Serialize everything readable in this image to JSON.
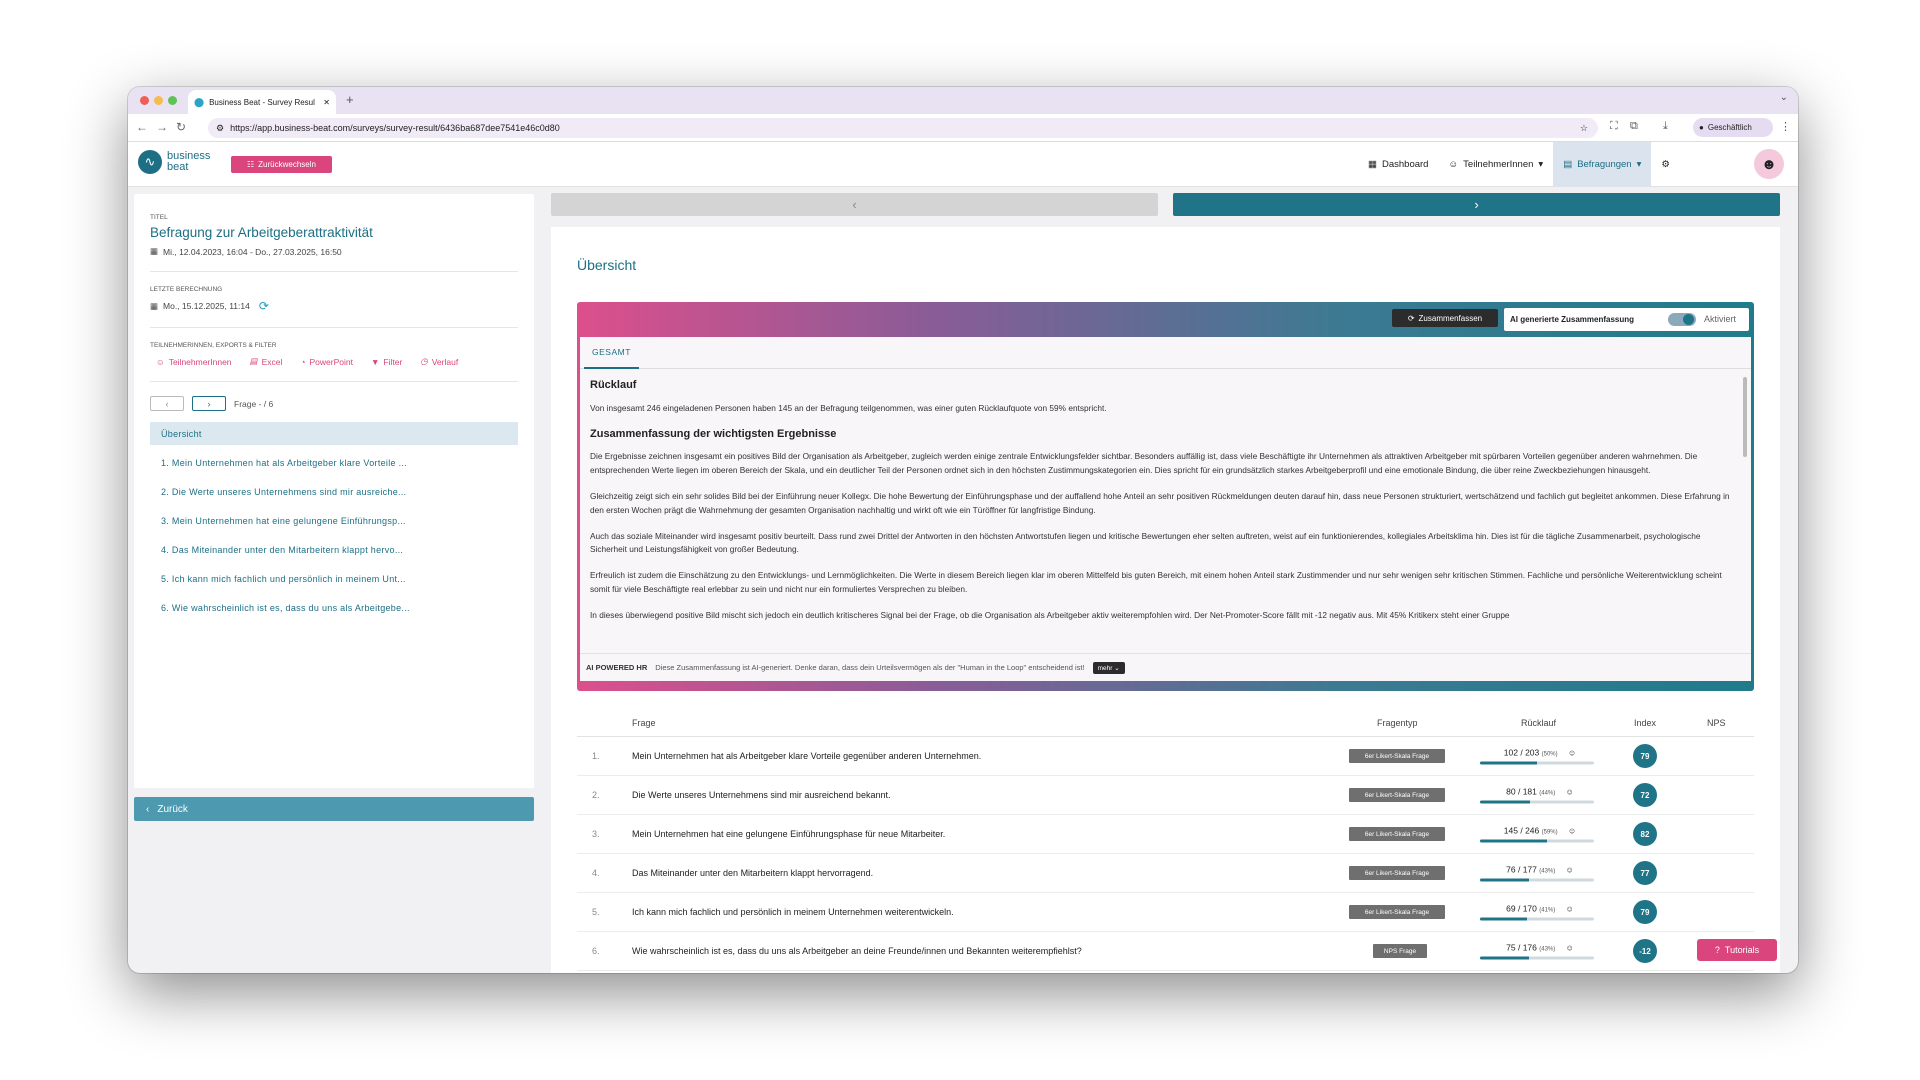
{
  "browser": {
    "tab_title": "Business Beat - Survey Resul",
    "url": "https://app.business-beat.com/surveys/survey-result/6436ba687dee7541e46c0d80",
    "profile_label": "Geschäftlich"
  },
  "header": {
    "logo_line1": "business",
    "logo_line2": "beat",
    "switch_label": "Zurückwechseln",
    "nav": {
      "dashboard": "Dashboard",
      "participants": "TeilnehmerInnen",
      "surveys": "Befragungen"
    }
  },
  "sidebar": {
    "title_label": "TITEL",
    "survey_title": "Befragung zur Arbeitgeberattraktivität",
    "date_range": "Mi., 12.04.2023, 16:04 - Do., 27.03.2025, 16:50",
    "last_calc_label": "LETZTE BERECHNUNG",
    "last_calc": "Mo., 15.12.2025, 11:14",
    "exports_label": "TEILNEHMERINNEN, EXPORTS & FILTER",
    "exports": {
      "participants": "TeilnehmerInnen",
      "excel": "Excel",
      "powerpoint": "PowerPoint",
      "filter": "Filter",
      "history": "Verlauf"
    },
    "question_counter": "Frage - / 6",
    "items": [
      {
        "label": "Übersicht"
      },
      {
        "label": "1. Mein Unternehmen hat als Arbeitgeber klare Vorteile ..."
      },
      {
        "label": "2. Die Werte unseres Unternehmens sind mir ausreiche..."
      },
      {
        "label": "3. Mein Unternehmen hat eine gelungene Einführungsp..."
      },
      {
        "label": "4. Das Miteinander unter den Mitarbeitern klappt hervo..."
      },
      {
        "label": "5. Ich kann mich fachlich und persönlich in meinem Unt..."
      },
      {
        "label": "6. Wie wahrscheinlich ist es, dass du uns als Arbeitgebe..."
      }
    ],
    "back_label": "Zurück"
  },
  "main": {
    "title": "Übersicht",
    "ai": {
      "summarize_label": "Zusammenfassen",
      "toggle_label": "AI generierte Zusammenfassung",
      "toggle_state": "Aktiviert",
      "tab_label": "GESAMT",
      "h_response": "Rücklauf",
      "p_response": "Von insgesamt 246 eingeladenen Personen haben 145 an der Befragung teilgenommen, was einer guten Rücklaufquote von 59% entspricht.",
      "h_summary": "Zusammenfassung der wichtigsten Ergebnisse",
      "p1": "Die Ergebnisse zeichnen insgesamt ein positives Bild der Organisation als Arbeitgeber, zugleich werden einige zentrale Entwicklungsfelder sichtbar. Besonders auffällig ist, dass viele Beschäftigte ihr Unternehmen als attraktiven Arbeitgeber mit spürbaren Vorteilen gegenüber anderen wahrnehmen. Die entsprechenden Werte liegen im oberen Bereich der Skala, und ein deutlicher Teil der Personen ordnet sich in den höchsten Zustimmungskategorien ein. Dies spricht für ein grundsätzlich starkes Arbeitgeberprofil und eine emotionale Bindung, die über reine Zweckbeziehungen hinausgeht.",
      "p2": "Gleichzeitig zeigt sich ein sehr solides Bild bei der Einführung neuer Kollegx. Die hohe Bewertung der Einführungsphase und der auffallend hohe Anteil an sehr positiven Rückmeldungen deuten darauf hin, dass neue Personen strukturiert, wertschätzend und fachlich gut begleitet ankommen. Diese Erfahrung in den ersten Wochen prägt die Wahrnehmung der gesamten Organisation nachhaltig und wirkt oft wie ein Türöffner für langfristige Bindung.",
      "p3": "Auch das soziale Miteinander wird insgesamt positiv beurteilt. Dass rund zwei Drittel der Antworten in den höchsten Antwortstufen liegen und kritische Bewertungen eher selten auftreten, weist auf ein funktionierendes, kollegiales Arbeitsklima hin. Dies ist für die tägliche Zusammenarbeit, psychologische Sicherheit und Leistungsfähigkeit von großer Bedeutung.",
      "p4": "Erfreulich ist zudem die Einschätzung zu den Entwicklungs- und Lernmöglichkeiten. Die Werte in diesem Bereich liegen klar im oberen Mittelfeld bis guten Bereich, mit einem hohen Anteil stark Zustimmender und nur sehr wenigen sehr kritischen Stimmen. Fachliche und persönliche Weiterentwicklung scheint somit für viele Beschäftigte real erlebbar zu sein und nicht nur ein formuliertes Versprechen zu bleiben.",
      "p5": "In dieses überwiegend positive Bild mischt sich jedoch ein deutlich kritischeres Signal bei der Frage, ob die Organisation als Arbeitgeber aktiv weiterempfohlen wird. Der Net-Promoter-Score fällt mit -12 negativ aus. Mit 45% Kritikerx steht einer Gruppe",
      "footer_brand": "AI POWERED HR",
      "footer_note": "Diese Zusammenfassung ist AI-generiert. Denke daran, dass dein Urteilsvermögen als der \"Human in the Loop\" entscheidend ist!",
      "more_label": "mehr"
    },
    "table": {
      "headers": {
        "question": "Frage",
        "type": "Fragentyp",
        "response": "Rücklauf",
        "index": "Index",
        "nps": "NPS"
      },
      "rows": [
        {
          "num": "1.",
          "question": "Mein Unternehmen hat als Arbeitgeber klare Vorteile gegenüber anderen Unternehmen.",
          "type": "6er Likert-Skala Frage",
          "response": "102 / 203",
          "pct": "(50%)",
          "fill": 0.5,
          "index": "79"
        },
        {
          "num": "2.",
          "question": "Die Werte unseres Unternehmens sind mir ausreichend bekannt.",
          "type": "6er Likert-Skala Frage",
          "response": "80 / 181",
          "pct": "(44%)",
          "fill": 0.44,
          "index": "72"
        },
        {
          "num": "3.",
          "question": "Mein Unternehmen hat eine gelungene Einführungsphase für neue Mitarbeiter.",
          "type": "6er Likert-Skala Frage",
          "response": "145 / 246",
          "pct": "(59%)",
          "fill": 0.59,
          "index": "82"
        },
        {
          "num": "4.",
          "question": "Das Miteinander unter den Mitarbeitern klappt hervorragend.",
          "type": "6er Likert-Skala Frage",
          "response": "76 / 177",
          "pct": "(43%)",
          "fill": 0.43,
          "index": "77"
        },
        {
          "num": "5.",
          "question": "Ich kann mich fachlich und persönlich in meinem Unternehmen weiterentwickeln.",
          "type": "6er Likert-Skala Frage",
          "response": "69 / 170",
          "pct": "(41%)",
          "fill": 0.41,
          "index": "79"
        },
        {
          "num": "6.",
          "question": "Wie wahrscheinlich ist es, dass du uns als Arbeitgeber an deine Freunde/innen und Bekannten weiterempfiehlst?",
          "type": "NPS Frage",
          "response": "75 / 176",
          "pct": "(43%)",
          "fill": 0.43,
          "index": "-12"
        }
      ]
    }
  },
  "tutorials_label": "Tutorials",
  "colors": {
    "primary": "#1f7488",
    "accent": "#d9457c"
  }
}
